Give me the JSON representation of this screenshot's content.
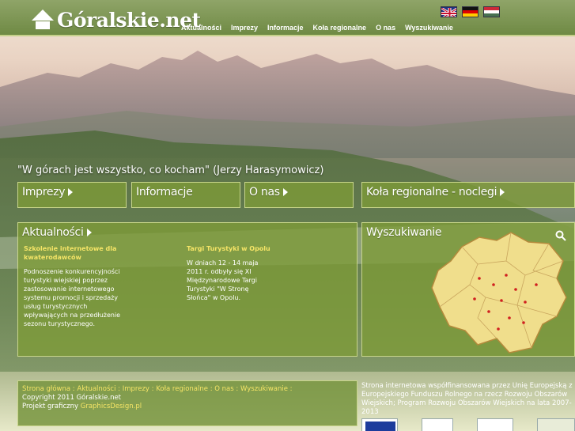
{
  "site": {
    "logo_text": "Góralskie.net"
  },
  "nav": [
    {
      "label": "Aktualności"
    },
    {
      "label": "Imprezy"
    },
    {
      "label": "Informacje"
    },
    {
      "label": "Koła regionalne"
    },
    {
      "label": "O nas"
    },
    {
      "label": "Wyszukiwanie"
    }
  ],
  "flags": [
    "flag-uk-icon",
    "flag-de-icon",
    "flag-hu-icon"
  ],
  "quote": "\"W górach jest wszystko, co kocham\" (Jerzy Harasymowicz)",
  "boxes": {
    "imprezy": "Imprezy",
    "informacje": "Informacje",
    "onas": "O nas",
    "kola": "Koła regionalne - noclegi",
    "aktualnosci": "Aktualności",
    "wyszukiwanie": "Wyszukiwanie"
  },
  "news": [
    {
      "title": "Szkolenie internetowe dla kwaterodawców",
      "body": "Podnoszenie konkurencyjności turystyki wiejskiej poprzez zastosowanie internetowego systemu promocji i sprzedaży usług turystycznych wpływających na przedłużenie sezonu turystycznego."
    },
    {
      "title": "Targi Turystyki w Opolu",
      "body": "W dniach 12 - 14 maja 2011 r. odbyły się XI Międzynarodowe Targi Turystyki \"W Stronę Słońca\" w Opolu."
    }
  ],
  "footer": {
    "links": [
      "Strona główna",
      "Aktualności",
      "Imprezy",
      "Koła regionalne",
      "O nas",
      "Wyszukiwanie"
    ],
    "copyright": "Copyright 2011 Góralskie.net",
    "project_prefix": "Projekt graficzny",
    "project_link": "GraphicsDesign.pl",
    "funding": "Strona internetowa współfinansowana przez Unię Europejską z Europejskiego Funduszu Rolnego na rzecz Rozwoju Obszarów Wiejskich; Program Rozwoju Obszarów Wiejskich na lata 2007-2013"
  },
  "colors": {
    "accent_yellow": "#f4e466",
    "box_green": "#7d9b37",
    "header_green": "#6f8a44"
  }
}
